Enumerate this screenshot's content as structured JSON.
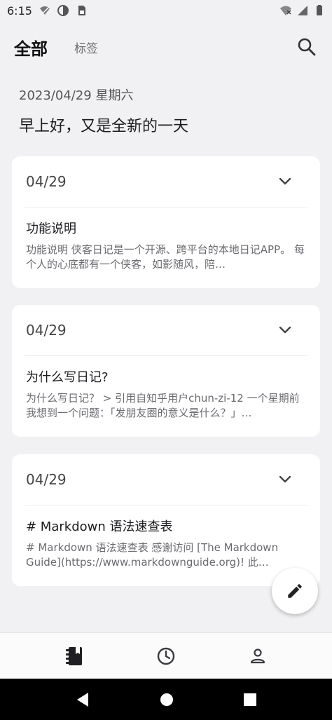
{
  "status_bar": {
    "time": "6:15",
    "left_icons": [
      "signal-off-icon",
      "data-saver-icon",
      "sim-card-icon"
    ],
    "right_icons": [
      "wifi-off-icon",
      "cellular-signal-icon",
      "battery-icon"
    ]
  },
  "header": {
    "tab_all": "全部",
    "tab_tags": "标签",
    "search_icon": "search-icon"
  },
  "greeting": {
    "date": "2023/04/29 星期六",
    "message": "早上好，又是全新的一天"
  },
  "diary_entries": [
    {
      "date": "04/29",
      "title": "功能说明",
      "preview": "功能说明 侠客日记是一个开源、跨平台的本地日记APP。 每个人的心底都有一个侠客，如影随风，陪…"
    },
    {
      "date": "04/29",
      "title": "为什么写日记?",
      "preview": "为什么写日记？ > 引用自知乎用户chun-zi-12 一个星期前我想到一个问题：「发朋友圈的意义是什么？」…"
    },
    {
      "date": "04/29",
      "title": "# Markdown 语法速查表",
      "preview": "# Markdown 语法速查表 感谢访问 [The Markdown Guide](https://www.markdownguide.org)! 此…"
    }
  ],
  "fab": {
    "icon": "edit-pencil-icon"
  },
  "bottom_nav": [
    {
      "icon": "diary-book-icon",
      "active": true
    },
    {
      "icon": "clock-history-icon",
      "active": false
    },
    {
      "icon": "person-profile-icon",
      "active": false
    }
  ],
  "colors": {
    "background": "#f1f1f3",
    "card": "#ffffff",
    "text_primary": "#1b1b1f",
    "text_secondary": "#6a6a70"
  }
}
